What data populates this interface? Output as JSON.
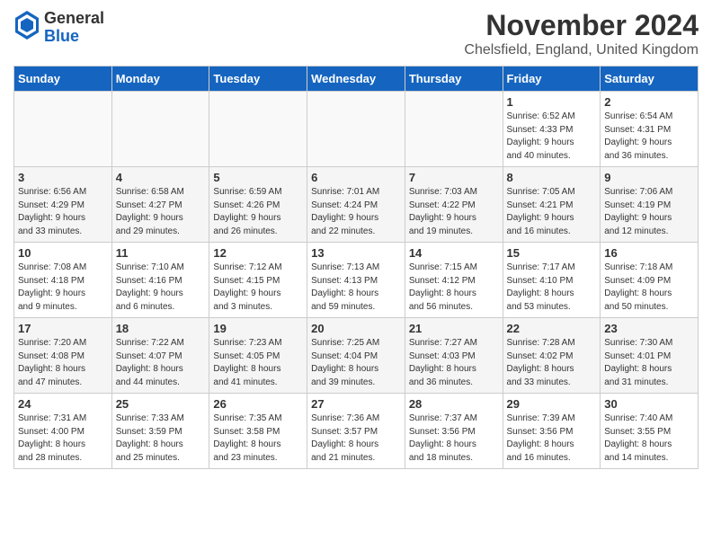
{
  "logo": {
    "general": "General",
    "blue": "Blue"
  },
  "title": "November 2024",
  "subtitle": "Chelsfield, England, United Kingdom",
  "days_of_week": [
    "Sunday",
    "Monday",
    "Tuesday",
    "Wednesday",
    "Thursday",
    "Friday",
    "Saturday"
  ],
  "weeks": [
    [
      {
        "day": "",
        "info": ""
      },
      {
        "day": "",
        "info": ""
      },
      {
        "day": "",
        "info": ""
      },
      {
        "day": "",
        "info": ""
      },
      {
        "day": "",
        "info": ""
      },
      {
        "day": "1",
        "info": "Sunrise: 6:52 AM\nSunset: 4:33 PM\nDaylight: 9 hours\nand 40 minutes."
      },
      {
        "day": "2",
        "info": "Sunrise: 6:54 AM\nSunset: 4:31 PM\nDaylight: 9 hours\nand 36 minutes."
      }
    ],
    [
      {
        "day": "3",
        "info": "Sunrise: 6:56 AM\nSunset: 4:29 PM\nDaylight: 9 hours\nand 33 minutes."
      },
      {
        "day": "4",
        "info": "Sunrise: 6:58 AM\nSunset: 4:27 PM\nDaylight: 9 hours\nand 29 minutes."
      },
      {
        "day": "5",
        "info": "Sunrise: 6:59 AM\nSunset: 4:26 PM\nDaylight: 9 hours\nand 26 minutes."
      },
      {
        "day": "6",
        "info": "Sunrise: 7:01 AM\nSunset: 4:24 PM\nDaylight: 9 hours\nand 22 minutes."
      },
      {
        "day": "7",
        "info": "Sunrise: 7:03 AM\nSunset: 4:22 PM\nDaylight: 9 hours\nand 19 minutes."
      },
      {
        "day": "8",
        "info": "Sunrise: 7:05 AM\nSunset: 4:21 PM\nDaylight: 9 hours\nand 16 minutes."
      },
      {
        "day": "9",
        "info": "Sunrise: 7:06 AM\nSunset: 4:19 PM\nDaylight: 9 hours\nand 12 minutes."
      }
    ],
    [
      {
        "day": "10",
        "info": "Sunrise: 7:08 AM\nSunset: 4:18 PM\nDaylight: 9 hours\nand 9 minutes."
      },
      {
        "day": "11",
        "info": "Sunrise: 7:10 AM\nSunset: 4:16 PM\nDaylight: 9 hours\nand 6 minutes."
      },
      {
        "day": "12",
        "info": "Sunrise: 7:12 AM\nSunset: 4:15 PM\nDaylight: 9 hours\nand 3 minutes."
      },
      {
        "day": "13",
        "info": "Sunrise: 7:13 AM\nSunset: 4:13 PM\nDaylight: 8 hours\nand 59 minutes."
      },
      {
        "day": "14",
        "info": "Sunrise: 7:15 AM\nSunset: 4:12 PM\nDaylight: 8 hours\nand 56 minutes."
      },
      {
        "day": "15",
        "info": "Sunrise: 7:17 AM\nSunset: 4:10 PM\nDaylight: 8 hours\nand 53 minutes."
      },
      {
        "day": "16",
        "info": "Sunrise: 7:18 AM\nSunset: 4:09 PM\nDaylight: 8 hours\nand 50 minutes."
      }
    ],
    [
      {
        "day": "17",
        "info": "Sunrise: 7:20 AM\nSunset: 4:08 PM\nDaylight: 8 hours\nand 47 minutes."
      },
      {
        "day": "18",
        "info": "Sunrise: 7:22 AM\nSunset: 4:07 PM\nDaylight: 8 hours\nand 44 minutes."
      },
      {
        "day": "19",
        "info": "Sunrise: 7:23 AM\nSunset: 4:05 PM\nDaylight: 8 hours\nand 41 minutes."
      },
      {
        "day": "20",
        "info": "Sunrise: 7:25 AM\nSunset: 4:04 PM\nDaylight: 8 hours\nand 39 minutes."
      },
      {
        "day": "21",
        "info": "Sunrise: 7:27 AM\nSunset: 4:03 PM\nDaylight: 8 hours\nand 36 minutes."
      },
      {
        "day": "22",
        "info": "Sunrise: 7:28 AM\nSunset: 4:02 PM\nDaylight: 8 hours\nand 33 minutes."
      },
      {
        "day": "23",
        "info": "Sunrise: 7:30 AM\nSunset: 4:01 PM\nDaylight: 8 hours\nand 31 minutes."
      }
    ],
    [
      {
        "day": "24",
        "info": "Sunrise: 7:31 AM\nSunset: 4:00 PM\nDaylight: 8 hours\nand 28 minutes."
      },
      {
        "day": "25",
        "info": "Sunrise: 7:33 AM\nSunset: 3:59 PM\nDaylight: 8 hours\nand 25 minutes."
      },
      {
        "day": "26",
        "info": "Sunrise: 7:35 AM\nSunset: 3:58 PM\nDaylight: 8 hours\nand 23 minutes."
      },
      {
        "day": "27",
        "info": "Sunrise: 7:36 AM\nSunset: 3:57 PM\nDaylight: 8 hours\nand 21 minutes."
      },
      {
        "day": "28",
        "info": "Sunrise: 7:37 AM\nSunset: 3:56 PM\nDaylight: 8 hours\nand 18 minutes."
      },
      {
        "day": "29",
        "info": "Sunrise: 7:39 AM\nSunset: 3:56 PM\nDaylight: 8 hours\nand 16 minutes."
      },
      {
        "day": "30",
        "info": "Sunrise: 7:40 AM\nSunset: 3:55 PM\nDaylight: 8 hours\nand 14 minutes."
      }
    ]
  ]
}
